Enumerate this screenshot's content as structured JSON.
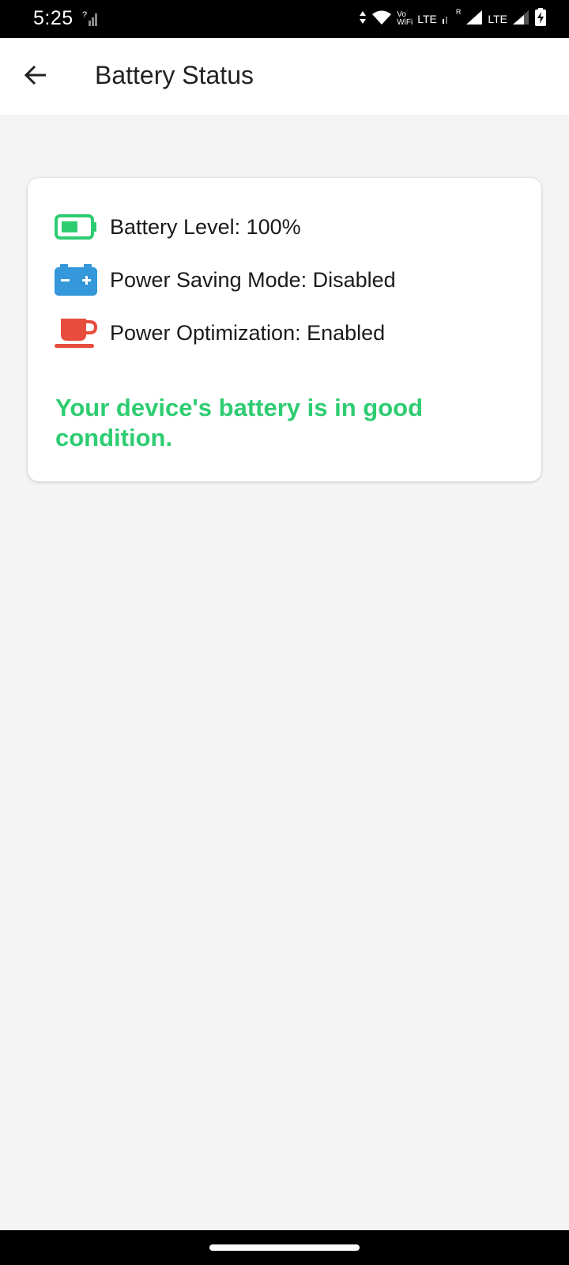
{
  "status_bar": {
    "time": "5:25",
    "lte1": "LTE",
    "lte2": "LTE",
    "vo_top": "Vo",
    "vo_bottom": "WiFi",
    "roaming": "R"
  },
  "app_bar": {
    "title": "Battery Status",
    "back_icon": "arrow-back-icon"
  },
  "card": {
    "items": [
      {
        "icon": "battery-icon",
        "label": "Battery Level: 100%",
        "color": "#2ecc71"
      },
      {
        "icon": "car-battery-icon",
        "label": "Power Saving Mode: Disabled",
        "color": "#3498db"
      },
      {
        "icon": "coffee-cup-icon",
        "label": "Power Optimization: Enabled",
        "color": "#e74c3c"
      }
    ],
    "message": "Your device's battery is in good condition.",
    "message_color": "#2ecc71"
  }
}
